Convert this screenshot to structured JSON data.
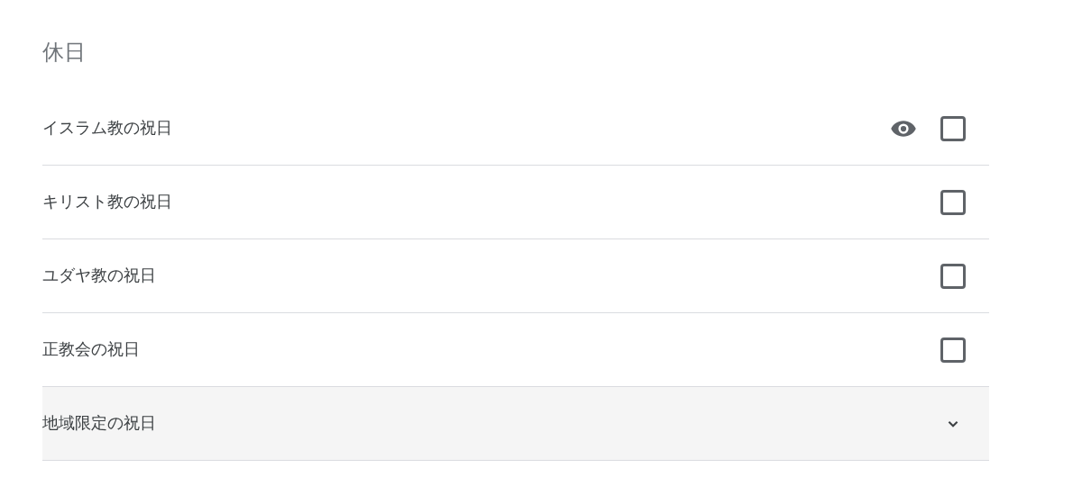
{
  "section_title": "休日",
  "items": [
    {
      "kind": "checkbox",
      "label": "イスラム教の祝日",
      "checked": false,
      "preview_visible": true
    },
    {
      "kind": "checkbox",
      "label": "キリスト教の祝日",
      "checked": false,
      "preview_visible": false
    },
    {
      "kind": "checkbox",
      "label": "ユダヤ教の祝日",
      "checked": false,
      "preview_visible": false
    },
    {
      "kind": "checkbox",
      "label": "正教会の祝日",
      "checked": false,
      "preview_visible": false
    },
    {
      "kind": "expander",
      "label": "地域限定の祝日",
      "expanded": false
    }
  ]
}
